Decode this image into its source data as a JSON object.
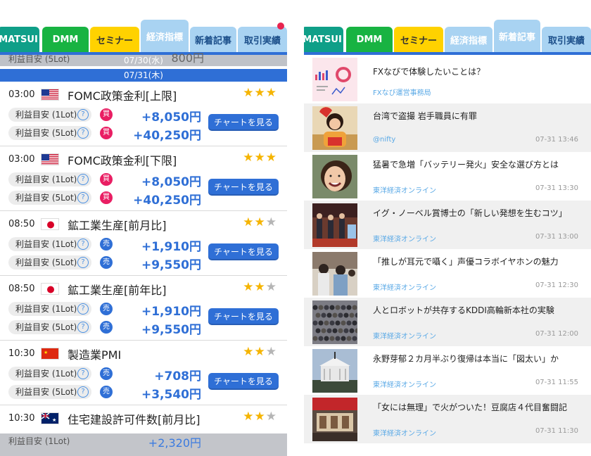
{
  "colors": {
    "blue": "#2f6fd6",
    "star_on": "#f5b400",
    "star_off": "#b5b5b5",
    "buy": "#e91e63",
    "sell": "#2f6fd6",
    "amount": "#2f6fd6",
    "right_row_alt": "#f0f0f0"
  },
  "left": {
    "tabs": [
      {
        "label": "MATSUI",
        "bg": "#0f9f88",
        "fg": "#ffffff",
        "active": false
      },
      {
        "label": "DMM",
        "bg": "#18b342",
        "fg": "#ffffff",
        "active": false
      },
      {
        "label": "セミナー",
        "bg": "#ffd200",
        "fg": "#333333",
        "active": false
      },
      {
        "label": "経済指標",
        "bg": "#a9d3f2",
        "fg": "#ffffff",
        "active": true
      },
      {
        "label": "新着記事",
        "bg": "#a9d3f2",
        "fg": "#1c4f8a",
        "active": false
      },
      {
        "label": "取引実績",
        "bg": "#a9d3f2",
        "fg": "#1c4f8a",
        "active": false
      }
    ],
    "prev_date": "07/30(水)",
    "prev_ghost_label": "利益目安 (5Lot)",
    "prev_ghost_amount": "800円",
    "current_date": "07/31(木)",
    "chart_button_label": "チャートを見る",
    "events": [
      {
        "time": "03:00",
        "flag": "us",
        "name": "FOMC政策金利[上限]",
        "stars": "★★★",
        "stars_off": "",
        "lots": [
          {
            "label": "利益目安 (1Lot)",
            "side": "買",
            "amount": "+8,050円"
          },
          {
            "label": "利益目安 (5Lot)",
            "side": "買",
            "amount": "+40,250円"
          }
        ]
      },
      {
        "time": "03:00",
        "flag": "us",
        "name": "FOMC政策金利[下限]",
        "stars": "★★★",
        "stars_off": "",
        "lots": [
          {
            "label": "利益目安 (1Lot)",
            "side": "買",
            "amount": "+8,050円"
          },
          {
            "label": "利益目安 (5Lot)",
            "side": "買",
            "amount": "+40,250円"
          }
        ]
      },
      {
        "time": "08:50",
        "flag": "jp",
        "name": "鉱工業生産[前月比]",
        "stars": "★★",
        "stars_off": "★",
        "lots": [
          {
            "label": "利益目安 (1Lot)",
            "side": "売",
            "amount": "+1,910円"
          },
          {
            "label": "利益目安 (5Lot)",
            "side": "売",
            "amount": "+9,550円"
          }
        ]
      },
      {
        "time": "08:50",
        "flag": "jp",
        "name": "鉱工業生産[前年比]",
        "stars": "★★",
        "stars_off": "★",
        "lots": [
          {
            "label": "利益目安 (1Lot)",
            "side": "売",
            "amount": "+1,910円"
          },
          {
            "label": "利益目安 (5Lot)",
            "side": "売",
            "amount": "+9,550円"
          }
        ]
      },
      {
        "time": "10:30",
        "flag": "cn",
        "name": "製造業PMI",
        "stars": "★★",
        "stars_off": "★",
        "lots": [
          {
            "label": "利益目安 (1Lot)",
            "side": "売",
            "amount": "+708円"
          },
          {
            "label": "利益目安 (5Lot)",
            "side": "売",
            "amount": "+3,540円"
          }
        ]
      },
      {
        "time": "10:30",
        "flag": "au",
        "name": "住宅建設許可件数[前月比]",
        "stars": "★★",
        "stars_off": "★",
        "lots": []
      }
    ],
    "bottom_ghost_label": "利益目安 (1Lot)",
    "bottom_ghost_amount": "+2,320円"
  },
  "right": {
    "tabs": [
      {
        "label": "MATSUI",
        "bg": "#0f9f88",
        "fg": "#ffffff",
        "active": false
      },
      {
        "label": "DMM",
        "bg": "#18b342",
        "fg": "#ffffff",
        "active": false
      },
      {
        "label": "セミナー",
        "bg": "#ffd200",
        "fg": "#333333",
        "active": false
      },
      {
        "label": "経済指標",
        "bg": "#a9d3f2",
        "fg": "#ffffff",
        "active": false
      },
      {
        "label": "新着記事",
        "bg": "#a9d3f2",
        "fg": "#ffffff",
        "active": true
      },
      {
        "label": "取引実績",
        "bg": "#a9d3f2",
        "fg": "#1c4f8a",
        "active": false
      }
    ],
    "news": [
      {
        "title": "FXなびで体験したいことは？",
        "source": "FXなび運営事務局",
        "time": "",
        "thumb": "chart-thumb"
      },
      {
        "title": "台湾で盗撮 岩手職員に有罪",
        "source": "@nifty",
        "time": "07-31 13:46",
        "thumb": "woman-thumb"
      },
      {
        "title": "猛暑で急増「バッテリー発火」安全な選び方とは",
        "source": "東洋経済オンライン",
        "time": "07-31 13:30",
        "thumb": "smile-thumb"
      },
      {
        "title": "イグ・ノーベル賞博士の「新しい発想を生むコツ」",
        "source": "東洋経済オンライン",
        "time": "07-31 13:00",
        "thumb": "stage-thumb"
      },
      {
        "title": "「推しが耳元で囁く」声優コラボイヤホンの魅力",
        "source": "東洋経済オンライン",
        "time": "07-31 12:30",
        "thumb": "crowd-thumb"
      },
      {
        "title": "人とロボットが共存するKDDI高輪新本社の実験",
        "source": "東洋経済オンライン",
        "time": "07-31 12:00",
        "thumb": "street-thumb"
      },
      {
        "title": "永野芽郁２カ月半ぶり復帰は本当に「図太い」か",
        "source": "東洋経済オンライン",
        "time": "07-31 11:55",
        "thumb": "house-thumb"
      },
      {
        "title": "「女には無理」で火がついた！豆腐店４代目奮闘記",
        "source": "東洋経済オンライン",
        "time": "07-31 11:30",
        "thumb": "shop-thumb"
      }
    ]
  }
}
